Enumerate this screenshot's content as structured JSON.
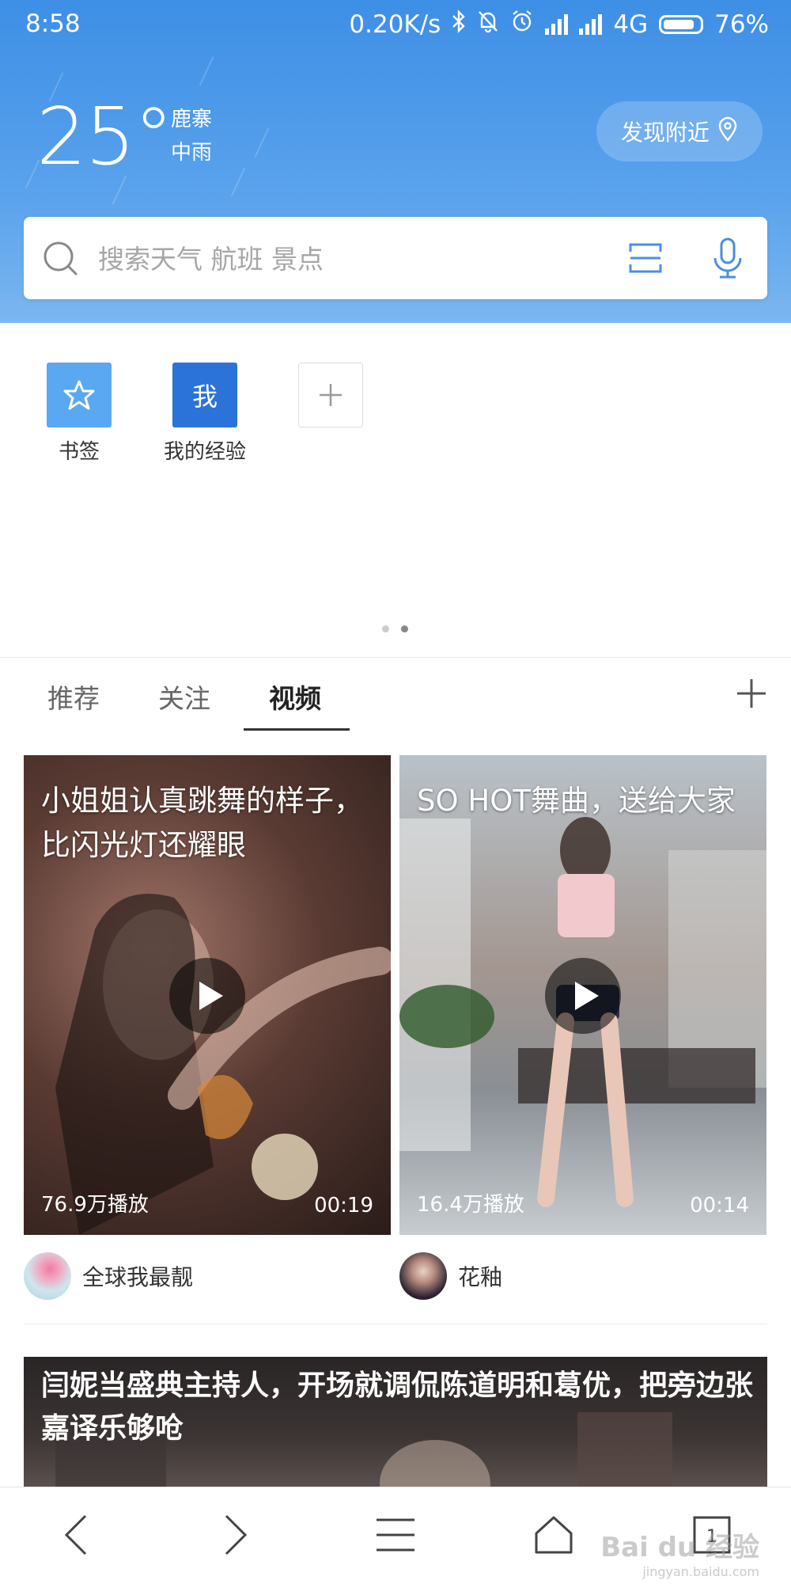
{
  "status_bar": {
    "time": "8:58",
    "net_speed": "0.20K/s",
    "network": "4G",
    "battery": "76%"
  },
  "weather": {
    "temperature": "25°",
    "city": "鹿寨",
    "condition": "中雨",
    "nearby_button": "发现附近"
  },
  "search": {
    "placeholder": "搜索天气 航班 景点"
  },
  "shortcuts": [
    {
      "label": "书签",
      "icon": "star-icon"
    },
    {
      "label": "我的经验",
      "glyph": "我"
    },
    {
      "label": "",
      "icon": "plus-icon"
    }
  ],
  "tabs": [
    "推荐",
    "关注",
    "视频"
  ],
  "active_tab": "视频",
  "videos": [
    {
      "title": "小姐姐认真跳舞的样子，比闪光灯还耀眼",
      "plays": "76.9万播放",
      "duration": "00:19",
      "author": "全球我最靓"
    },
    {
      "title": "SO HOT舞曲，送给大家",
      "plays": "16.4万播放",
      "duration": "00:14",
      "author": "花釉"
    }
  ],
  "news": {
    "title": "闫妮当盛典主持人，开场就调侃陈道明和葛优，把旁边张嘉译乐够呛"
  },
  "bottom_nav": [
    "back-icon",
    "forward-icon",
    "menu-icon",
    "home-icon",
    "tabs-icon"
  ],
  "watermark": {
    "text": "Bai du 经验",
    "sub": "jingyan.baidu.com"
  },
  "colors": {
    "header_blue": "#4a97e9",
    "accent_blue": "#2b73d9",
    "light_blue": "#5aa7f2"
  }
}
